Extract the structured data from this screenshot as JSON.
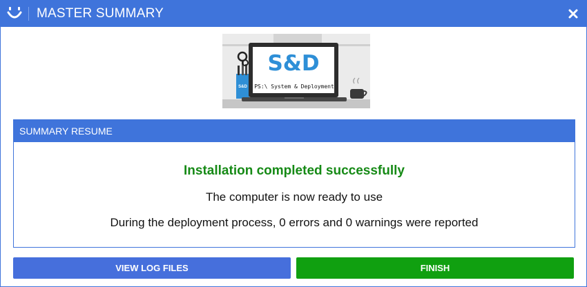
{
  "window": {
    "title": "MASTER SUMMARY",
    "close_icon": "close-x-icon",
    "app_icon": "smiley-icon"
  },
  "banner": {
    "logo_text": "S&D",
    "screen_caption": "PS:\\ System & Deployment",
    "cup_label": "S&D"
  },
  "summary": {
    "header": "SUMMARY RESUME",
    "status_title": "Installation completed successfully",
    "line1": "The computer is now ready to use",
    "line2": "During the deployment process, 0 errors and 0 warnings were reported"
  },
  "buttons": {
    "view_log": "VIEW LOG FILES",
    "finish": "FINISH"
  },
  "colors": {
    "accent": "#3f74db",
    "success": "#168a16",
    "finish_button": "#10a010"
  }
}
